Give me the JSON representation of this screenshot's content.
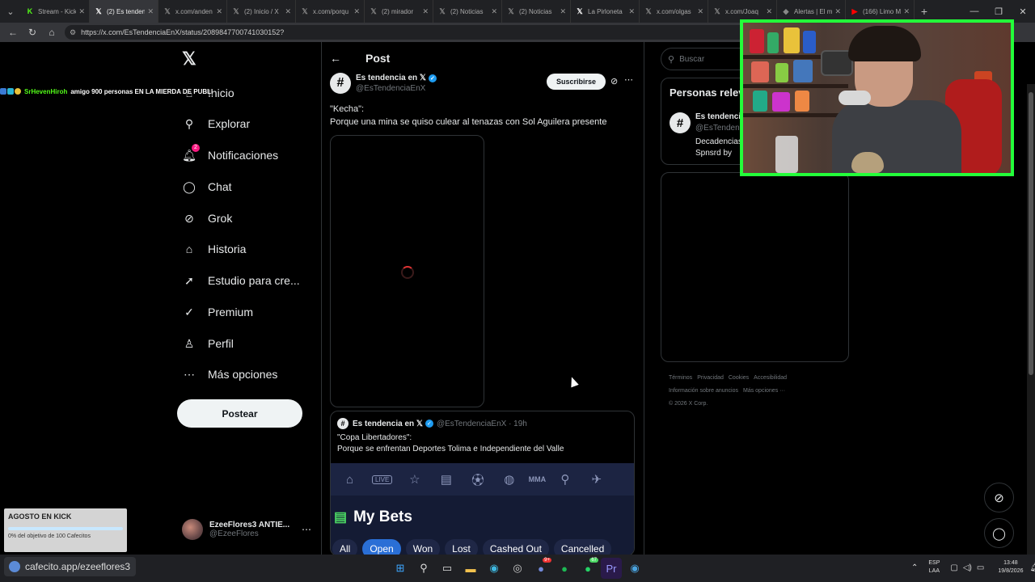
{
  "browser": {
    "tabs": [
      {
        "label": "Stream - Kick",
        "icon": "kick-icon",
        "active": false,
        "color": "#53fc18"
      },
      {
        "label": "(2) Es tenden",
        "icon": "x-icon",
        "active": true,
        "color": "#ffffff"
      },
      {
        "label": "x.com/anden",
        "icon": "x-icon",
        "active": false,
        "color": "#888888"
      },
      {
        "label": "(2) Inicio / X",
        "icon": "x-icon",
        "active": false,
        "color": "#888888"
      },
      {
        "label": "x.com/porqu",
        "icon": "x-icon",
        "active": false,
        "color": "#888888"
      },
      {
        "label": "(2) mirador",
        "icon": "x-icon",
        "active": false,
        "color": "#888888"
      },
      {
        "label": "(2) Noticias",
        "icon": "x-icon",
        "active": false,
        "color": "#888888"
      },
      {
        "label": "(2) Noticias",
        "icon": "x-icon",
        "active": false,
        "color": "#888888"
      },
      {
        "label": "La Pirloneta",
        "icon": "x-icon",
        "active": false,
        "color": "#ffffff"
      },
      {
        "label": "x.com/olgas",
        "icon": "x-icon",
        "active": false,
        "color": "#888888"
      },
      {
        "label": "x.com/Joaq",
        "icon": "x-icon",
        "active": false,
        "color": "#888888"
      },
      {
        "label": "Alertas | El m",
        "icon": "streamelements-icon",
        "active": false,
        "color": "#888888"
      },
      {
        "label": "(166) Limo M",
        "icon": "youtube-icon",
        "active": false,
        "color": "#ff0000"
      }
    ],
    "url": "https://x.com/EsTendenciaEnX/status/2089847700741030152?"
  },
  "nav": {
    "logo": "𝕏",
    "items": [
      {
        "label": "Inicio",
        "icon": "home-icon",
        "glyph": "⌂"
      },
      {
        "label": "Explorar",
        "icon": "search-icon",
        "glyph": "⚲"
      },
      {
        "label": "Notificaciones",
        "icon": "bell-icon",
        "glyph": "🔔︎",
        "badge": "2"
      },
      {
        "label": "Chat",
        "icon": "chat-icon",
        "glyph": "◯"
      },
      {
        "label": "Grok",
        "icon": "grok-icon",
        "glyph": "⊘"
      },
      {
        "label": "Historia",
        "icon": "bookmark-icon",
        "glyph": "⌂"
      },
      {
        "label": "Estudio para cre...",
        "icon": "rocket-icon",
        "glyph": "➚"
      },
      {
        "label": "Premium",
        "icon": "verified-icon",
        "glyph": "✓"
      },
      {
        "label": "Perfil",
        "icon": "person-icon",
        "glyph": "♙"
      },
      {
        "label": "Más opciones",
        "icon": "more-circle-icon",
        "glyph": "⋯"
      }
    ],
    "post_button": "Postear",
    "account": {
      "name": "EzeeFlores3 ANTIE...",
      "handle": "@EzeeFlores"
    }
  },
  "post": {
    "header": "Post",
    "author": "Es tendencia en 𝕏",
    "handle": "@EsTendenciaEnX",
    "subscribe": "Suscribirse",
    "text_line1": "\"Kecha\":",
    "text_line2": "Porque una mina se quiso culear al tenazas con Sol Aguilera presente",
    "quote": {
      "author": "Es tendencia en 𝕏",
      "handle": "@EsTendenciaEnX · 19h",
      "line1": "\"Copa Libertadores\":",
      "line2": "Porque se enfrentan Deportes Tolima e Independiente del Valle",
      "bets_title": "My Bets",
      "bets_tabs": [
        "All",
        "Open",
        "Won",
        "Lost",
        "Cashed Out",
        "Cancelled"
      ],
      "bets_live": "LIVE",
      "bets_mma": "MMA"
    }
  },
  "right": {
    "search_placeholder": "Buscar",
    "card_title": "Personas relevantes",
    "card_name": "Es tendencia en 𝕏",
    "card_handle": "@EsTendenciaEnX",
    "card_desc1": "Decadencias",
    "card_desc2": "Spnsrd by",
    "footer": [
      "Términos",
      "Privacidad",
      "Cookies",
      "Accesibilidad",
      "Información sobre anuncios",
      "Más opciones ···",
      "© 2026 X Corp."
    ]
  },
  "chat_overlay": {
    "user": "SrHevenHiroh",
    "message": "amigo 900 personas EN LA MIERDA DE PUBLI"
  },
  "goal": {
    "title": "AGOSTO EN KICK",
    "text": "0% del objetivo de 100 Cafecitos",
    "progress": 0
  },
  "taskbar": {
    "link": "cafecito.app/ezeeflores3",
    "lang1": "ESP",
    "lang2": "LAA",
    "time": "13:48",
    "date": "19/8/2026",
    "badge_discord": "9+",
    "badge_whatsapp": "67"
  },
  "colors": {
    "accent": "#1d9bf0",
    "cam_border": "#23ff3a",
    "kick_green": "#53fc18"
  }
}
